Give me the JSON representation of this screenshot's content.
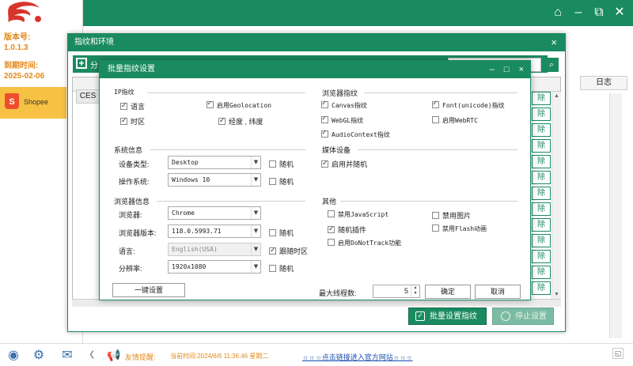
{
  "sidebar": {
    "version_label": "版本号:",
    "version_value": "1.0.1.3",
    "expiry_label": "到期时间:",
    "expiry_value": "2025-02-06",
    "platform_name": "Shopee"
  },
  "window_controls": [
    "home-icon",
    "minimize-icon",
    "restore-icon",
    "close-icon"
  ],
  "background": {
    "log_header": "日志"
  },
  "fingerprint_dialog": {
    "title": "指纹和环境",
    "close": "×",
    "toolbar_first_label": "分",
    "row_label": "CES",
    "delete_label": "除",
    "batch_button": "批量设置指纹",
    "stop_button": "停止设置"
  },
  "batch_dialog": {
    "title": "批量指纹设置",
    "controls": [
      "–",
      "□",
      "×"
    ],
    "ip_section": {
      "title": "IP指纹",
      "items": [
        {
          "label": "语言",
          "checked": true
        },
        {
          "label": "启用Geolocation",
          "checked": true
        },
        {
          "label": "时区",
          "checked": true
        },
        {
          "label": "经度 , 纬度",
          "checked": true
        }
      ]
    },
    "browser_fp_section": {
      "title": "浏览器指纹",
      "items": [
        {
          "label": "Canvas指纹",
          "checked": true
        },
        {
          "label": "Font(unicode)指纹",
          "checked": true
        },
        {
          "label": "WebGL指纹",
          "checked": true
        },
        {
          "label": "启用WebRTC",
          "checked": false
        },
        {
          "label": "AudioContext指纹",
          "checked": true
        }
      ]
    },
    "system_section": {
      "title": "系统信息",
      "device_label": "设备类型:",
      "device_value": "Desktop",
      "os_label": "操作系统:",
      "os_value": "Windows 10",
      "random_label": "随机"
    },
    "media_section": {
      "title": "媒体设备",
      "enable_random": "启用并随机"
    },
    "browser_info_section": {
      "title": "浏览器信息",
      "browser_label": "浏览器:",
      "browser_value": "Chrome",
      "version_label": "浏览器版本:",
      "version_value": "118.0.5993.71",
      "language_label": "语言:",
      "language_value": "English(USA)",
      "follow_timezone": "跟随时区",
      "resolution_label": "分辨率:",
      "resolution_value": "1920x1080",
      "random_label": "随机"
    },
    "other_section": {
      "title": "其他",
      "items": [
        {
          "label": "禁用JavaScript",
          "checked": false
        },
        {
          "label": "禁用图片",
          "checked": false
        },
        {
          "label": "随机插件",
          "checked": true
        },
        {
          "label": "禁用Flash动画",
          "checked": false
        },
        {
          "label": "启用DoNotTrack功能",
          "checked": false
        }
      ]
    },
    "one_click_button": "一键设置",
    "max_threads_label": "最大线程数:",
    "max_threads_value": "5",
    "confirm_button": "确定",
    "cancel_button": "取消"
  },
  "statusbar": {
    "tip_label": "友情提醒:",
    "current_time": "当前时间:2024/6/6 11:36:46 星期二",
    "official_link": "☼☼☼点击链接进入官方网站☼☼☼"
  }
}
